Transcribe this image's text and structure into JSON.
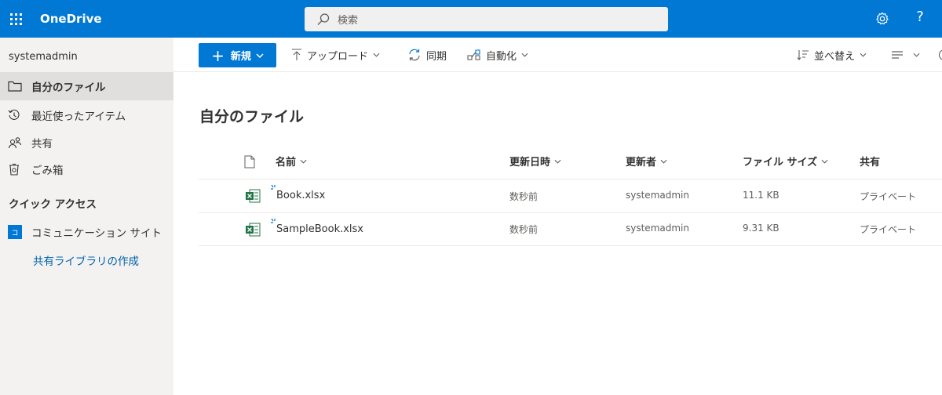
{
  "suitebar": {
    "app_name": "OneDrive",
    "search_placeholder": "検索",
    "settings_icon": "gear-icon",
    "help_label": "?"
  },
  "leftnav": {
    "user": "systemadmin",
    "items": [
      {
        "label": "自分のファイル",
        "icon": "folder-icon",
        "selected": true
      },
      {
        "label": "最近使ったアイテム",
        "icon": "history-icon"
      },
      {
        "label": "共有",
        "icon": "people-icon"
      },
      {
        "label": "ごみ箱",
        "icon": "recycle-bin-icon"
      }
    ],
    "quick_access_title": "クイック アクセス",
    "sites": [
      {
        "label": "コミュニケーション サイト",
        "icon_letter": "コ"
      }
    ],
    "create_library": "共有ライブラリの作成"
  },
  "commandbar": {
    "new_label": "新規",
    "upload_label": "アップロード",
    "sync_label": "同期",
    "automate_label": "自動化",
    "sort_label": "並べ替え"
  },
  "main": {
    "title": "自分のファイル",
    "columns": {
      "name": "名前",
      "modified": "更新日時",
      "modified_by": "更新者",
      "size": "ファイル サイズ",
      "sharing": "共有"
    },
    "files": [
      {
        "name": "Book.xlsx",
        "modified": "数秒前",
        "modified_by": "systemadmin",
        "size": "11.1 KB",
        "sharing": "プライベート"
      },
      {
        "name": "SampleBook.xlsx",
        "modified": "数秒前",
        "modified_by": "systemadmin",
        "size": "9.31 KB",
        "sharing": "プライベート"
      }
    ]
  },
  "colors": {
    "brand": "#0078d4",
    "nav_bg": "#f3f2f1",
    "excel_green": "#217346"
  }
}
